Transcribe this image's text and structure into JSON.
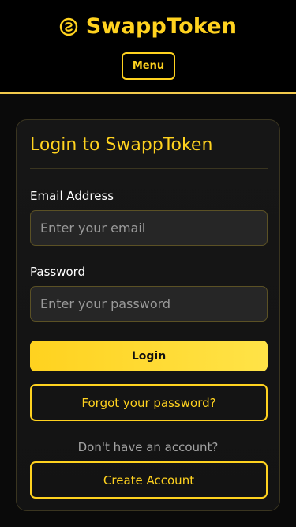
{
  "header": {
    "brand_name": "SwappToken",
    "brand_icon": "swap-coin-icon",
    "menu_label": "Menu"
  },
  "login_card": {
    "title": "Login to SwappToken",
    "email": {
      "label": "Email Address",
      "placeholder": "Enter your email",
      "value": ""
    },
    "password": {
      "label": "Password",
      "placeholder": "Enter your password",
      "value": ""
    },
    "login_label": "Login",
    "forgot_label": "Forgot your password?",
    "signup_prompt": "Don't have an account?",
    "create_account_label": "Create Account"
  },
  "colors": {
    "accent": "#ffd21f",
    "background": "#0a0a0a",
    "card": "#151515",
    "input": "#262626"
  }
}
